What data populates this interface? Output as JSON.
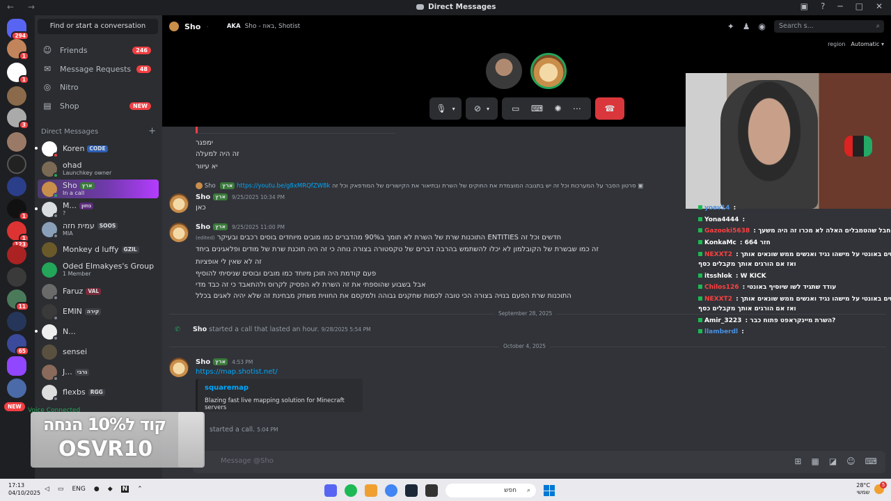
{
  "window": {
    "title": "Direct Messages",
    "nav_icons": "← →"
  },
  "server_badges": [
    "294",
    "1",
    "1",
    "3",
    "1",
    "1",
    "123",
    "11",
    "65"
  ],
  "server_new_label": "NEW",
  "sidebar": {
    "find_placeholder": "Find or start a conversation",
    "nav": [
      {
        "label": "Friends",
        "count": "246",
        "icon": "friends-icon"
      },
      {
        "label": "Message Requests",
        "count": "48",
        "icon": "envelope-icon"
      },
      {
        "label": "Nitro",
        "count": "",
        "icon": "nitro-icon"
      },
      {
        "label": "Shop",
        "count": "NEW",
        "icon": "shop-icon"
      }
    ],
    "dm_header": "Direct Messages",
    "dm_add": "+",
    "dms": [
      {
        "name": "Koren",
        "tag": "CODE",
        "sub": ""
      },
      {
        "name": "ohad",
        "tag": "",
        "sub": "Launchkey owner"
      },
      {
        "name": "Sho",
        "tag": "ארץ",
        "sub": "In a call"
      },
      {
        "name": "M...",
        "tag": "נוזון",
        "sub": "?"
      },
      {
        "name": "עמית חזה",
        "tag": "SOOS",
        "sub": "MIA"
      },
      {
        "name": "Monkey d luffy",
        "tag": "GZIL",
        "sub": ""
      },
      {
        "name": "Oded Elmakyes's Group",
        "tag": "",
        "sub": "1 Member"
      },
      {
        "name": "Faruz",
        "tag": "VAL",
        "sub": ""
      },
      {
        "name": "EMIN",
        "tag": "קירה",
        "sub": ""
      },
      {
        "name": "N...",
        "tag": "",
        "sub": ""
      },
      {
        "name": "sensei",
        "tag": "",
        "sub": ""
      },
      {
        "name": "J...",
        "tag": "גרבי",
        "sub": ""
      },
      {
        "name": "flexbs",
        "tag": "RGG",
        "sub": ""
      }
    ],
    "voice_connected": "Voice Connected"
  },
  "header": {
    "channel_name": "Sho",
    "aka_label": "AKA",
    "aka_names": "Sho - באוז, Shotist",
    "search_placeholder": "Search s...",
    "region_label": "region",
    "region_value": "Automatic"
  },
  "chat": {
    "pre_lines": [
      "ימפגר",
      "זה היה למעלה",
      "יא עיוור"
    ],
    "reply_snippet": "סרטון הסבר על המערכות וכל זה יש בתגובה המוצמדת את החוקים של השרת ובתיאור את הקישורים של המודפאק וכל זה",
    "reply_author": "Sho",
    "reply_link": "https://youtu.be/g8xMRQfZW8k",
    "messages": [
      {
        "author": "Sho",
        "tag": "ארץ",
        "time": "9/25/2025 10:34 PM",
        "lines": [
          "כאן"
        ]
      },
      {
        "author": "Sho",
        "tag": "ארץ",
        "time": "9/25/2025 11:00 PM",
        "lines": [
          "התוכנות שרת של השרת לא תומך ב90% מהדברים כמו מובים מיוחדים בוסים רכבים ובעיקר ENTITIES חדשים וכל זה",
          "זה כמו שבשרת של הקובלמון לא יכלו להשתמש בהרבה דברים של טקסטורה בצורה נוחה כי זה היה תוכנת שרת של מודים ופלאגינים ביחד",
          "זה לא שאין לי אופציות",
          "פעם קודמת היה תוכן מיוחד כמו מובים ובוסים שניסיתי להוסיף",
          "אבל בשבוע שהוספתי את זה השרת לא הפסיק לקרוס ולהתאבד כי זה כבד מדי",
          "התוכנות שרת הפעם בנויה בצורה הכי טובה לכמות שחקנים גבוהה ולמקסם את החווית משחק מבחינת זה שלא יהיה לאגים בכלל"
        ],
        "edited": "(edited)"
      },
      {
        "author": "Sho",
        "tag": "ארץ",
        "time": "4:53 PM",
        "lines": [
          "https://map.shotist.net/"
        ]
      }
    ],
    "date_1": "September 28, 2025",
    "call_author": "Sho",
    "call_text": "started a call that lasted an hour.",
    "call_time": "9/28/2025 5:54 PM",
    "date_2": "October 4, 2025",
    "embed_title": "squaremap",
    "embed_desc": "Blazing fast live mapping solution for Minecraft servers",
    "call2_text": "started a call.",
    "call2_time": "5:04 PM",
    "composer_placeholder": "Message @Sho"
  },
  "twitch_chat": [
    {
      "user": "yoav14",
      "msg": "",
      "color": "#4a90e2"
    },
    {
      "user": "Yona4444",
      "msg": "",
      "color": "#ffffff"
    },
    {
      "user": "Gazooki5638",
      "msg": "כן חבל שהטמבלים האלה לא מכרו זה היה משעך",
      "color": "#ff4040"
    },
    {
      "user": "KonkaMc",
      "msg": "חזר 664",
      "color": "#ffffff"
    },
    {
      "user": "NEXXT2",
      "msg": "לשים באונטי על מישהו נגיד ואנשים ממש שונאים אותך",
      "color": "#ff4040"
    },
    {
      "user": "",
      "msg": "ואז אם הורגים אותך מקבלים כסף",
      "color": "#ffffff"
    },
    {
      "user": "itsshlok",
      "msg": "W KICK",
      "color": "#ffffff"
    },
    {
      "user": "Chilos126",
      "msg": "עודד שתגיד לשו שיוסיף באונטי",
      "color": "#ff4040"
    },
    {
      "user": "NEXXT2",
      "msg": "לשים באונטי על מישהו נגיד ואנשים ממש שונאים אותך",
      "color": "#ff4040"
    },
    {
      "user": "",
      "msg": "ואז אם הורגים אותך מקבלים כסף",
      "color": "#ffffff"
    },
    {
      "user": "Amir_3223",
      "msg": "השרת מיינקראפט פתוח כבר?",
      "color": "#ffffff"
    },
    {
      "user": "llamberdl",
      "msg": "",
      "color": "#4a90e2"
    }
  ],
  "promo": {
    "line1": "קוד ל10% הנחה",
    "line2": "OSVR10"
  },
  "taskbar": {
    "time": "17:13",
    "date": "04/10/2025",
    "lang": "ENG",
    "search_placeholder": "חפש",
    "temp": "28°C",
    "weather": "שמשי",
    "notif_count": "5"
  }
}
